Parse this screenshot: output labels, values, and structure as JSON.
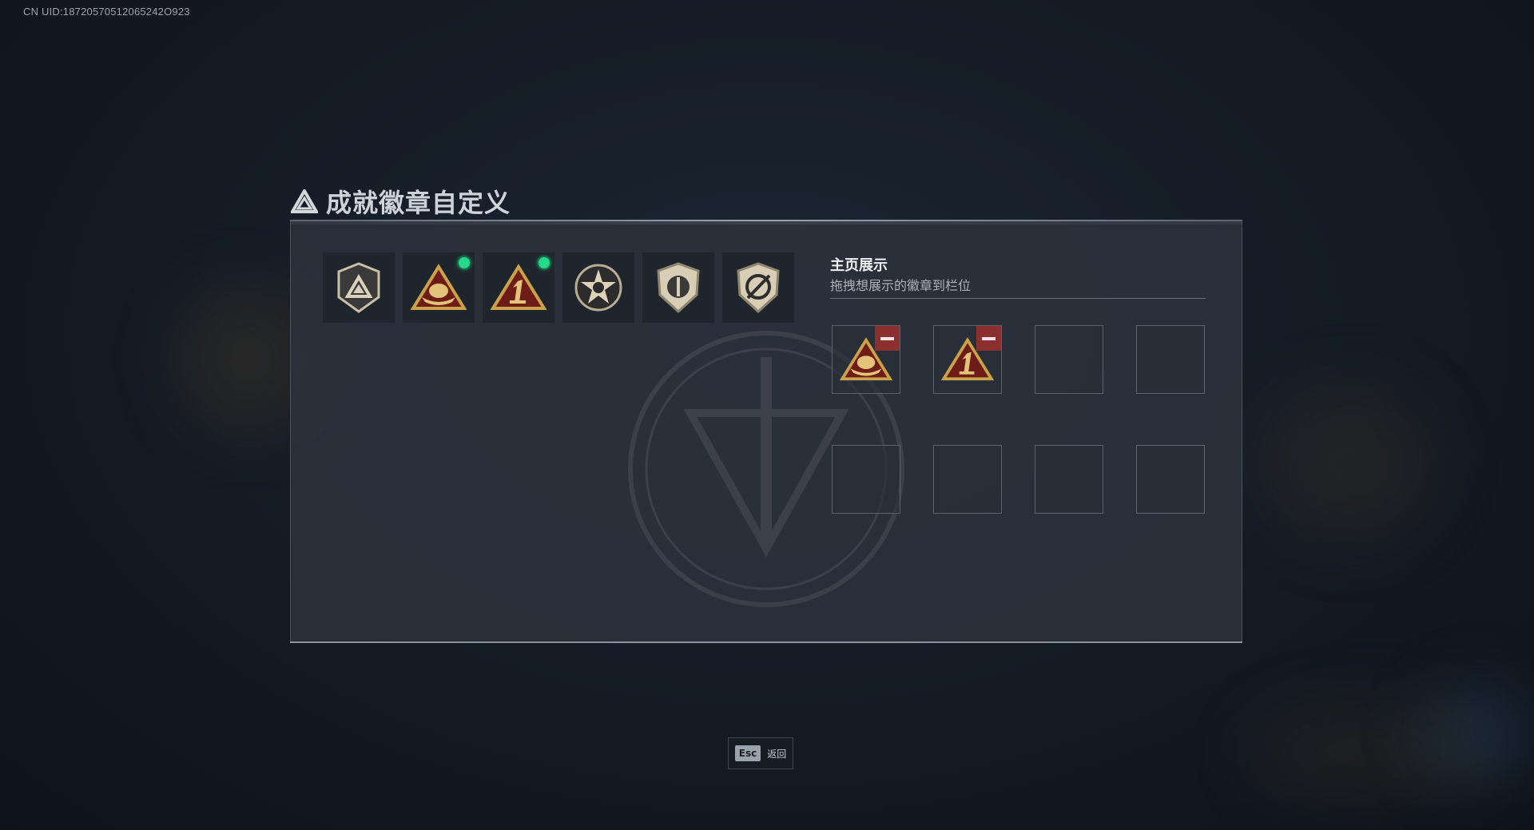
{
  "uid_text": "CN UID:18720570512065242O923",
  "page": {
    "title": "成就徽章自定义",
    "title_icon": "triangle-emblem-icon"
  },
  "badges": [
    {
      "icon": "shield-triangle-badge-icon",
      "new": false
    },
    {
      "icon": "boat-triangle-badge-icon",
      "new": true
    },
    {
      "icon": "number-one-triangle-badge-icon",
      "new": true
    },
    {
      "icon": "star-medal-badge-icon",
      "new": false
    },
    {
      "icon": "shield-emblem-badge-icon",
      "new": false
    },
    {
      "icon": "crossed-circle-badge-icon",
      "new": false
    }
  ],
  "showcase": {
    "title": "主页展示",
    "subtitle": "拖拽想展示的徽章到栏位",
    "slots": [
      {
        "badge": "boat-triangle-badge-icon"
      },
      {
        "badge": "number-one-triangle-badge-icon"
      },
      {
        "badge": null
      },
      {
        "badge": null
      },
      {
        "badge": null
      },
      {
        "badge": null
      },
      {
        "badge": null
      },
      {
        "badge": null
      }
    ]
  },
  "footer": {
    "esc_key": "Esc",
    "esc_label": "返回"
  },
  "colors": {
    "accent_gold": "#c9a24a",
    "badge_red": "#7a1f1a",
    "new_dot": "#25d98a",
    "remove": "#8c2f2f"
  }
}
